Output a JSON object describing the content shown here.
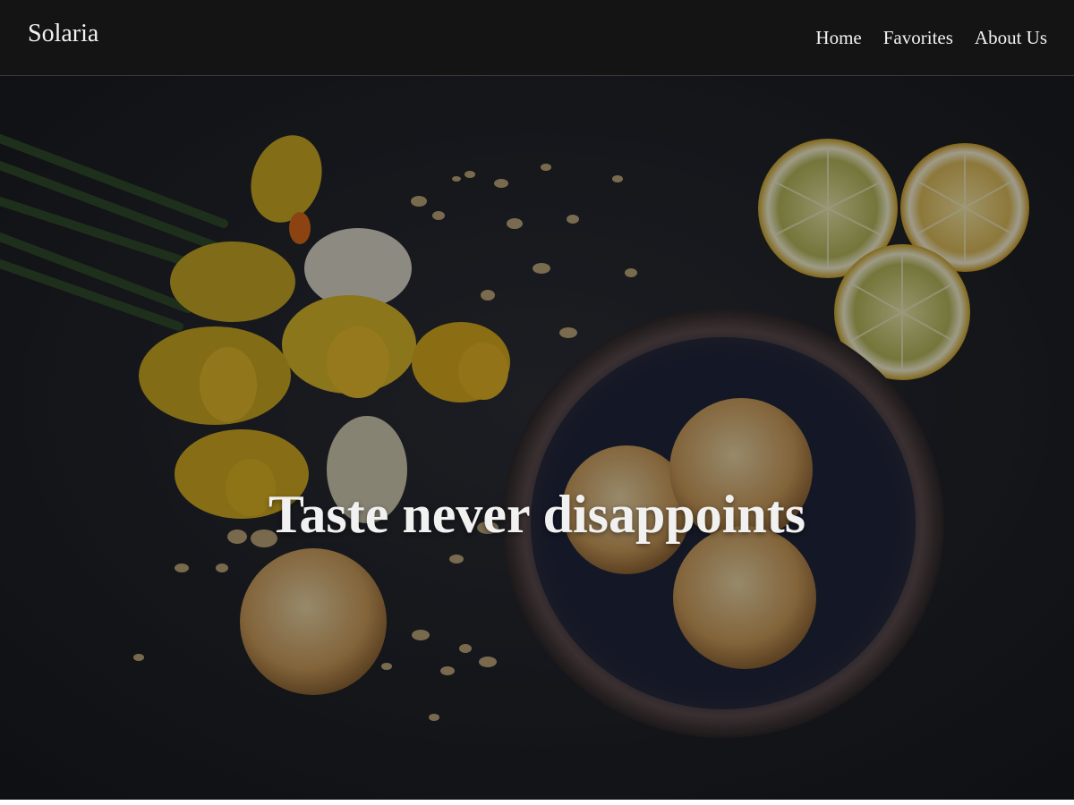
{
  "navbar": {
    "brand": "Solaria",
    "links": [
      {
        "label": "Home"
      },
      {
        "label": "Favorites"
      },
      {
        "label": "About Us"
      }
    ]
  },
  "hero": {
    "title": "Taste never disappoints",
    "image_description_icon": "food-photo"
  },
  "colors": {
    "navbar_bg": "#141414",
    "hero_bg": "#22252c",
    "text": "#f2f2f2"
  }
}
